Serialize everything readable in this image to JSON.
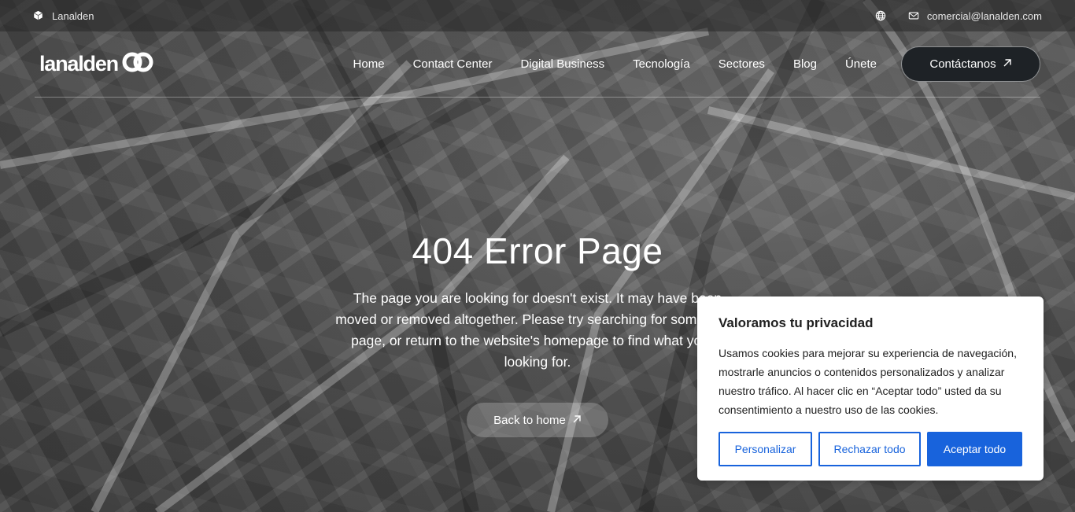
{
  "topbar": {
    "brand": "Lanalden",
    "email": "comercial@lanalden.com"
  },
  "header": {
    "logo_text": "lanalden",
    "nav": [
      "Home",
      "Contact Center",
      "Digital Business",
      "Tecnología",
      "Sectores",
      "Blog",
      "Únete"
    ],
    "cta_label": "Contáctanos"
  },
  "hero": {
    "title": "404 Error Page",
    "message": "The page you are looking for doesn't exist. It may have been moved or removed altogether. Please try searching for some other page, or return to the website's homepage to find what you're looking for.",
    "button_label": "Back to home"
  },
  "cookie": {
    "title": "Valoramos tu privacidad",
    "text": "Usamos cookies para mejorar su experiencia de navegación, mostrarle anuncios o contenidos personalizados y analizar nuestro tráfico. Al hacer clic en “Aceptar todo” usted da su consentimiento a nuestro uso de las cookies.",
    "customize_label": "Personalizar",
    "reject_label": "Rechazar todo",
    "accept_label": "Aceptar todo"
  },
  "colors": {
    "accent": "#1863dc",
    "cta_bg": "#1e2226"
  }
}
